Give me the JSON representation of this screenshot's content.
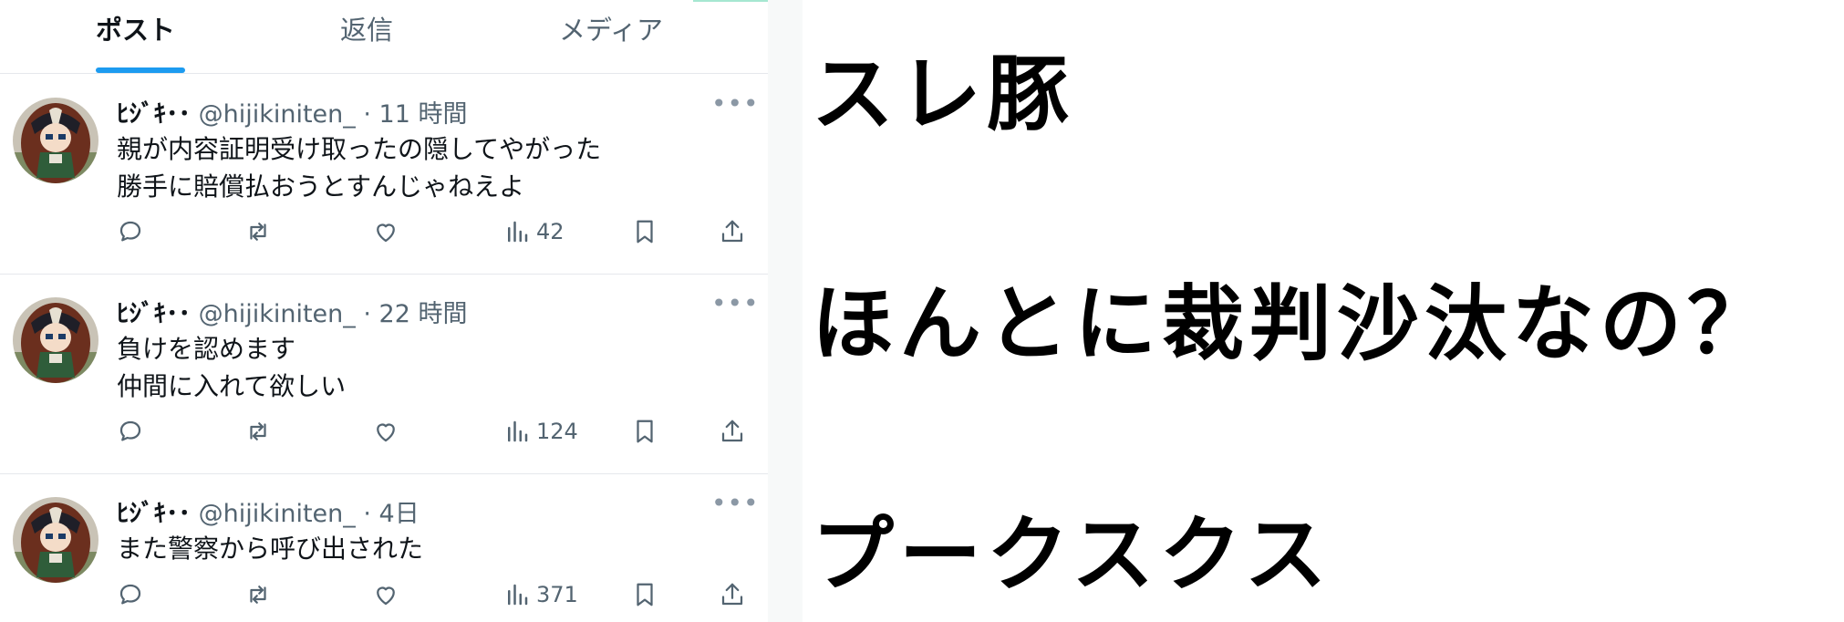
{
  "tabs": [
    "ポスト",
    "返信",
    "メディア"
  ],
  "colors": {
    "accent": "#1d9bf0",
    "text": "#0f1419",
    "muted": "#536471",
    "divider": "#e5e8ec"
  },
  "posts": [
    {
      "name": "ﾋｼﾞｷ･･",
      "handle": "@hijikiniten_",
      "time": "· 11 時間",
      "lines": [
        "親が内容証明受け取ったの隠してやがった",
        "勝手に賠償払おうとすんじゃねえよ"
      ],
      "views": "42"
    },
    {
      "name": "ﾋｼﾞｷ･･",
      "handle": "@hijikiniten_",
      "time": "· 22 時間",
      "lines": [
        "負けを認めます",
        "仲間に入れて欲しい"
      ],
      "views": "124"
    },
    {
      "name": "ﾋｼﾞｷ･･",
      "handle": "@hijikiniten_",
      "time": "· 4日",
      "lines": [
        "また警察から呼び出された"
      ],
      "views": "371"
    }
  ],
  "more_label": "•••",
  "icons": [
    "reply-icon",
    "repost-icon",
    "like-icon",
    "views-icon",
    "bookmark-icon",
    "share-icon"
  ],
  "caption": {
    "line1": "スレ豚",
    "line2": "ほんとに裁判沙汰なの？",
    "line3": "プークスクス"
  }
}
